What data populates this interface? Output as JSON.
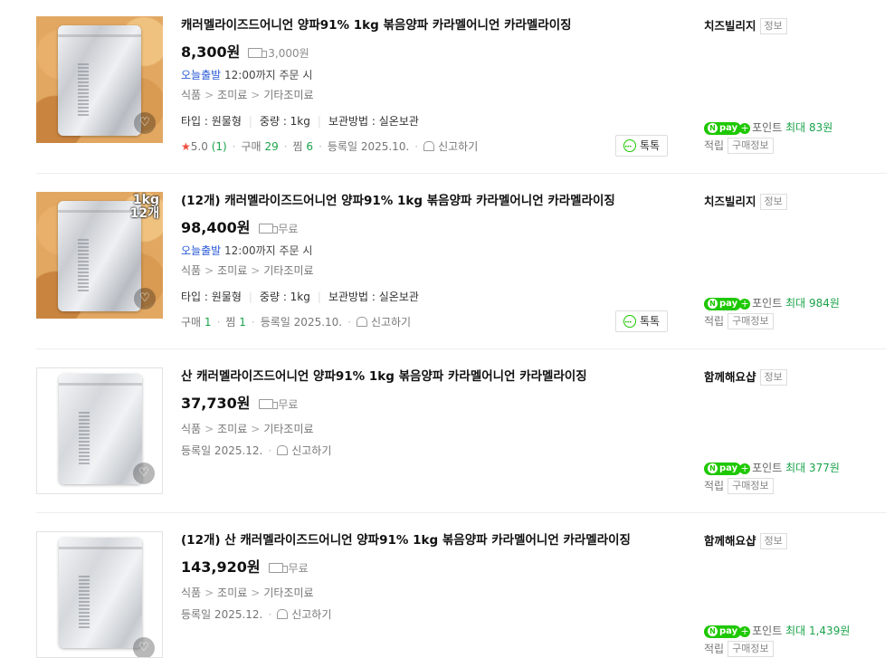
{
  "products": [
    {
      "title": "캐러멜라이즈드어니언 양파91% 1kg 볶음양파 카라멜어니언 카라멜라이징",
      "price": "8,300원",
      "shipping": "3,000원",
      "dispatch_label": "오늘출발",
      "dispatch_note": "12:00까지 주문 시",
      "category": [
        "식품",
        "조미료",
        "기타조미료"
      ],
      "specs": [
        "타입 : 원물형",
        "중량 : 1kg",
        "보관방법 : 실온보관"
      ],
      "rating": "5.0",
      "rating_count": "(1)",
      "purchase_label": "구매",
      "purchase_count": "29",
      "wish_label": "찜",
      "wish_count": "6",
      "registered": "등록일 2025.10.",
      "report": "신고하기",
      "talk": "톡톡",
      "store": "치즈빌리지",
      "store_tag": "정보",
      "points_label": "포인트",
      "points_value": "최대 83원",
      "accum_label": "적립",
      "accum_tag": "구매정보"
    },
    {
      "title": "(12개) 캐러멜라이즈드어니언 양파91% 1kg 볶음양파 카라멜어니언 카라멜라이징",
      "image_badge": [
        "1kg",
        "12개"
      ],
      "price": "98,400원",
      "shipping": "무료",
      "dispatch_label": "오늘출발",
      "dispatch_note": "12:00까지 주문 시",
      "category": [
        "식품",
        "조미료",
        "기타조미료"
      ],
      "specs": [
        "타입 : 원물형",
        "중량 : 1kg",
        "보관방법 : 실온보관"
      ],
      "purchase_label": "구매",
      "purchase_count": "1",
      "wish_label": "찜",
      "wish_count": "1",
      "registered": "등록일 2025.10.",
      "report": "신고하기",
      "talk": "톡톡",
      "store": "치즈빌리지",
      "store_tag": "정보",
      "points_label": "포인트",
      "points_value": "최대 984원",
      "accum_label": "적립",
      "accum_tag": "구매정보"
    },
    {
      "title": "산 캐러멜라이즈드어니언 양파91% 1kg 볶음양파 카라멜어니언 카라멜라이징",
      "price": "37,730원",
      "shipping": "무료",
      "category": [
        "식품",
        "조미료",
        "기타조미료"
      ],
      "registered": "등록일 2025.12.",
      "report": "신고하기",
      "store": "함께해요샵",
      "store_tag": "정보",
      "points_label": "포인트",
      "points_value": "최대 377원",
      "accum_label": "적립",
      "accum_tag": "구매정보"
    },
    {
      "title": "(12개) 산 캐러멜라이즈드어니언 양파91% 1kg 볶음양파 카라멜어니언 카라멜라이징",
      "price": "143,920원",
      "shipping": "무료",
      "category": [
        "식품",
        "조미료",
        "기타조미료"
      ],
      "registered": "등록일 2025.12.",
      "report": "신고하기",
      "store": "함께해요샵",
      "store_tag": "정보",
      "points_label": "포인트",
      "points_value": "최대 1,439원",
      "accum_label": "적립",
      "accum_tag": "구매정보"
    }
  ],
  "npay_label": "pay",
  "colors": {
    "green": "#1ec800",
    "point_green": "#1aa34a",
    "dispatch_blue": "#2a5ad6",
    "star_red": "#f04e3e"
  },
  "icons": [
    "delivery-truck-icon",
    "heart-icon",
    "bell-report-icon",
    "talk-chat-icon",
    "npay-logo-icon"
  ]
}
